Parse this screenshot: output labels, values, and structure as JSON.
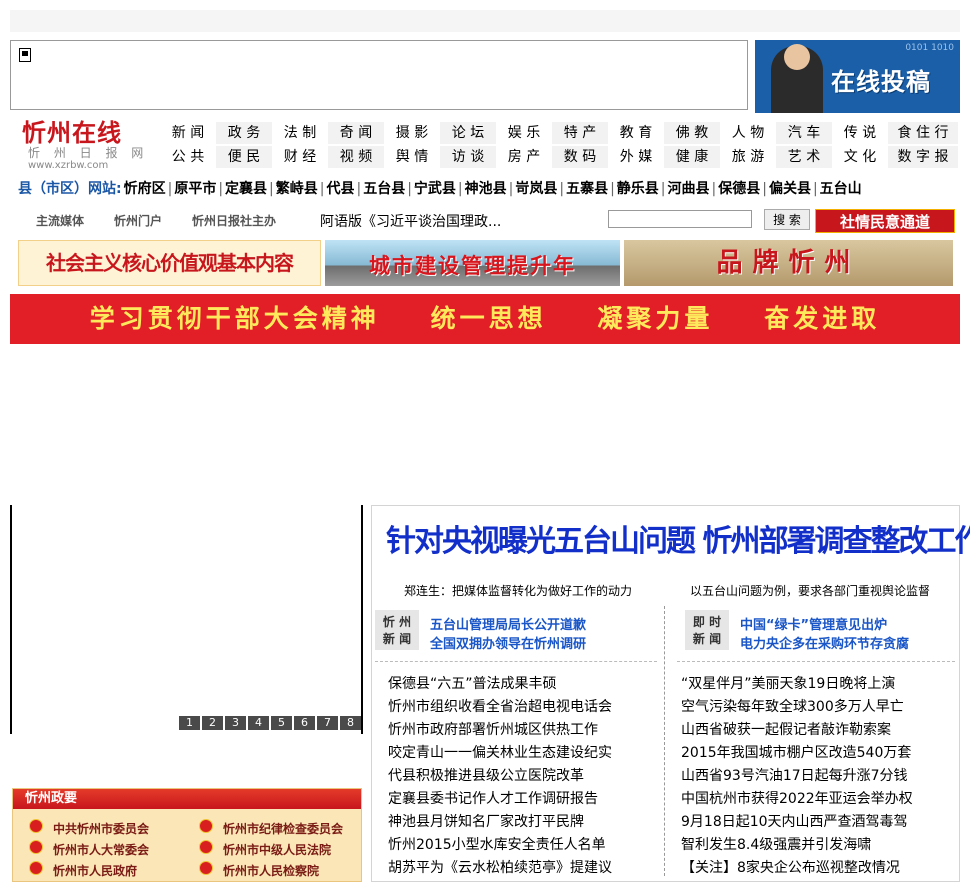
{
  "logo": {
    "name": "忻州在线",
    "subtitle": "忻 州 日 报 网",
    "url": "www.xzrbw.com"
  },
  "ad_tougao": {
    "label": "在线投稿"
  },
  "nav": {
    "row1": [
      "新 闻",
      "政 务",
      "法 制",
      "奇 闻",
      "摄 影",
      "论 坛",
      "娱 乐",
      "特 产",
      "教 育",
      "佛 教",
      "人 物",
      "汽 车",
      "传 说",
      "食 住 行"
    ],
    "row2": [
      "公 共",
      "便 民",
      "财 经",
      "视 频",
      "舆 情",
      "访 谈",
      "房 产",
      "数 码",
      "外 媒",
      "健 康",
      "旅 游",
      "艺 术",
      "文 化",
      "数 字 报"
    ]
  },
  "counties": {
    "label": "县（市区）网站:",
    "items": [
      "忻府区",
      "原平市",
      "定襄县",
      "繁峙县",
      "代县",
      "五台县",
      "宁武县",
      "神池县",
      "岢岚县",
      "五寨县",
      "静乐县",
      "河曲县",
      "保德县",
      "偏关县",
      "五台山"
    ]
  },
  "sublinks": [
    "主流媒体",
    "忻州门户",
    "忻州日报社主办"
  ],
  "ticker": "阿语版《习近平谈治国理政...",
  "search": {
    "button": "搜 索",
    "placeholder": ""
  },
  "sheqing": "社情民意通道",
  "banners": {
    "b1": "社会主义核心价值观基本内容",
    "b2": "城市建设管理提升年",
    "b3": "品牌忻州"
  },
  "red_banner": "学习贯彻干部大会精神    统一思想    凝聚力量    奋发进取",
  "slideshow": {
    "dots": [
      "1",
      "2",
      "3",
      "4",
      "5",
      "6",
      "7",
      "8"
    ]
  },
  "gov": {
    "title": "忻州政要",
    "items": [
      "中共忻州市委员会",
      "忻州市纪律检查委员会",
      "忻州市人大常委会",
      "忻州市中级人民法院",
      "忻州市人民政府",
      "忻州市人民检察院"
    ]
  },
  "headline": {
    "title": "针对央视曝光五台山问题 忻州部署调查整改工作",
    "sub_left": "郑连生：把媒体监督转化为做好工作的动力",
    "sub_right": "以五台山问题为例，要求各部门重视舆论监督"
  },
  "left_col": {
    "tag": [
      "忻 州",
      "新 闻"
    ],
    "top_links": [
      "五台山管理局局长公开道歉",
      "全国双拥办领导在忻州调研"
    ],
    "items": [
      "保德县“六五”普法成果丰硕",
      "忻州市组织收看全省治超电视电话会",
      "忻州市政府部署忻州城区供热工作",
      "咬定青山一一偏关林业生态建设纪实",
      "代县积极推进县级公立医院改革",
      "定襄县委书记作人才工作调研报告",
      "神池县月饼知名厂家改打平民牌",
      "忻州2015小型水库安全责任人名单",
      "胡苏平为《云水松柏续范亭》提建议"
    ]
  },
  "right_col": {
    "tag": [
      "即 时",
      "新 闻"
    ],
    "top_links": [
      "中国“绿卡”管理意见出炉",
      "电力央企多在采购环节存贪腐"
    ],
    "items": [
      "“双星伴月”美丽天象19日晚将上演",
      "空气污染每年致全球300多万人早亡",
      "山西省破获一起假记者敲诈勒索案",
      "2015年我国城市棚户区改造540万套",
      "山西省93号汽油17日起每升涨7分钱",
      "中国杭州市获得2022年亚运会举办权",
      "9月18日起10天内山西严查酒驾毒驾",
      "智利发生8.4级强震并引发海啸",
      "【关注】8家央企公布巡视整改情况"
    ]
  },
  "colors": {
    "brand_red": "#c8161d",
    "link_blue": "#1a56c7",
    "headline_blue": "#1230c9"
  }
}
